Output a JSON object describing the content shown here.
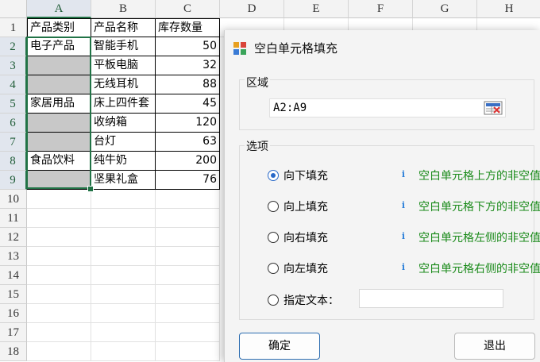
{
  "sheet": {
    "columns": [
      "A",
      "B",
      "C",
      "D",
      "E",
      "F",
      "G",
      "H"
    ],
    "rows": [
      "1",
      "2",
      "3",
      "4",
      "5",
      "6",
      "7",
      "8",
      "9",
      "10",
      "11",
      "12",
      "13",
      "14",
      "15",
      "16",
      "17",
      "18"
    ],
    "header": [
      "产品类别",
      "产品名称",
      "库存数量"
    ],
    "data": [
      {
        "cat": "电子产品",
        "name": "智能手机",
        "qty": "50"
      },
      {
        "cat": "",
        "name": "平板电脑",
        "qty": "32"
      },
      {
        "cat": "",
        "name": "无线耳机",
        "qty": "88"
      },
      {
        "cat": "家居用品",
        "name": "床上四件套",
        "qty": "45"
      },
      {
        "cat": "",
        "name": "收纳箱",
        "qty": "120"
      },
      {
        "cat": "",
        "name": "台灯",
        "qty": "63"
      },
      {
        "cat": "食品饮料",
        "name": "纯牛奶",
        "qty": "200"
      },
      {
        "cat": "",
        "name": "坚果礼盒",
        "qty": "76"
      }
    ]
  },
  "dialog": {
    "title": "空白单元格填充",
    "range_label": "区域",
    "range_value": "A2:A9",
    "options_label": "选项",
    "options": [
      {
        "label": "向下填充",
        "hint": "空白单元格上方的非空值",
        "selected": true
      },
      {
        "label": "向上填充",
        "hint": "空白单元格下方的非空值",
        "selected": false
      },
      {
        "label": "向右填充",
        "hint": "空白单元格左侧的非空值",
        "selected": false
      },
      {
        "label": "向左填充",
        "hint": "空白单元格右侧的非空值",
        "selected": false
      }
    ],
    "custom_text_label": "指定文本：",
    "custom_text_value": "",
    "info_glyph": "i",
    "ok_label": "确定",
    "exit_label": "退出"
  },
  "colors": {
    "accent": "#217346",
    "radio": "#2868c8",
    "hint": "#1a8a1a",
    "blank_fill": "#c8c8c8"
  }
}
